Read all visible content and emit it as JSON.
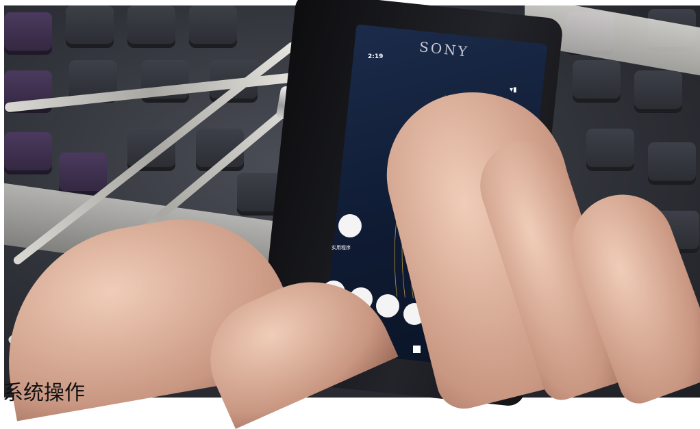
{
  "device": {
    "brand": "SONY",
    "status_time": "2:19",
    "status_icons": "▾▮",
    "app_label": "实用程序",
    "nav_back_glyph": "◀"
  },
  "caption": "系统操作"
}
